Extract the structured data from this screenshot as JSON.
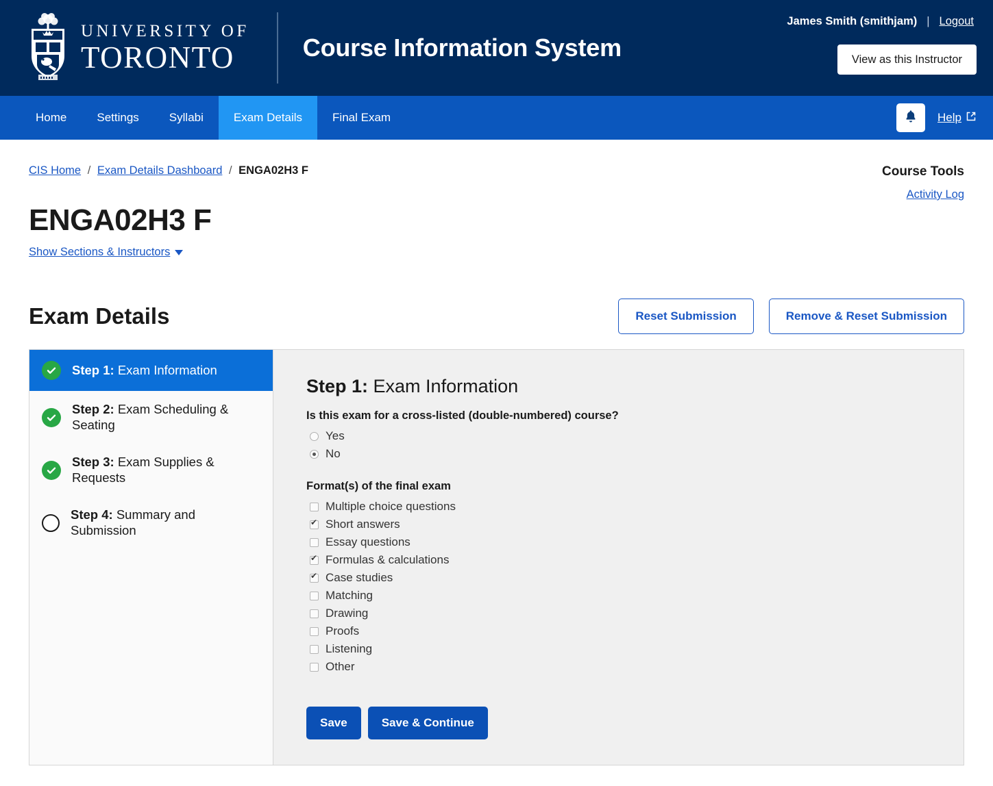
{
  "header": {
    "logo": {
      "line1": "UNIVERSITY OF",
      "line2": "TORONTO",
      "crest_icon": "uoft-crest-icon"
    },
    "app_title": "Course Information System",
    "user_name": "James Smith (smithjam)",
    "separator": "|",
    "logout_label": "Logout",
    "view_as_instructor_label": "View as this Instructor"
  },
  "nav": {
    "items": [
      {
        "label": "Home",
        "active": false
      },
      {
        "label": "Settings",
        "active": false
      },
      {
        "label": "Syllabi",
        "active": false
      },
      {
        "label": "Exam Details",
        "active": true
      },
      {
        "label": "Final Exam",
        "active": false
      }
    ],
    "notifications_icon": "bell-icon",
    "help_label": "Help",
    "help_external_icon": "external-link-icon"
  },
  "breadcrumb": {
    "item1": "CIS Home",
    "item2": "Exam Details Dashboard",
    "current": "ENGA02H3 F",
    "separator": "/"
  },
  "course_tools": {
    "title": "Course Tools",
    "links": [
      "Activity Log"
    ]
  },
  "course": {
    "code": "ENGA02H3 F",
    "show_sections_label": "Show Sections & Instructors"
  },
  "section": {
    "title": "Exam Details",
    "reset_label": "Reset Submission",
    "remove_reset_label": "Remove & Reset Submission"
  },
  "wizard": {
    "steps": [
      {
        "num": "Step 1:",
        "name": " Exam Information",
        "state": "done",
        "active": true
      },
      {
        "num": "Step 2:",
        "name": " Exam Scheduling & Seating",
        "state": "done",
        "active": false
      },
      {
        "num": "Step 3:",
        "name": " Exam Supplies & Requests",
        "state": "done",
        "active": false
      },
      {
        "num": "Step 4:",
        "name": " Summary and Submission",
        "state": "todo",
        "active": false
      }
    ]
  },
  "panel": {
    "title_num": "Step 1:",
    "title_name": " Exam Information",
    "crosslist_question": "Is this exam for a cross-listed (double-numbered) course?",
    "crosslist_options": [
      {
        "label": "Yes",
        "checked": false
      },
      {
        "label": "No",
        "checked": true
      }
    ],
    "formats_label": "Format(s) of the final exam",
    "formats": [
      {
        "label": "Multiple choice questions",
        "checked": false
      },
      {
        "label": "Short answers",
        "checked": true
      },
      {
        "label": "Essay questions",
        "checked": false
      },
      {
        "label": "Formulas & calculations",
        "checked": true
      },
      {
        "label": "Case studies",
        "checked": true
      },
      {
        "label": "Matching",
        "checked": false
      },
      {
        "label": "Drawing",
        "checked": false
      },
      {
        "label": "Proofs",
        "checked": false
      },
      {
        "label": "Listening",
        "checked": false
      },
      {
        "label": "Other",
        "checked": false
      }
    ],
    "save_label": "Save",
    "save_continue_label": "Save & Continue"
  },
  "colors": {
    "header_navy": "#002a5c",
    "nav_blue": "#0b57bd",
    "nav_active_blue": "#2196f3",
    "link_blue": "#1a57c4",
    "primary_button": "#0b50b5",
    "step_active": "#0b6fd8",
    "step_done_green": "#28a745",
    "panel_bg": "#f0f0f0"
  }
}
